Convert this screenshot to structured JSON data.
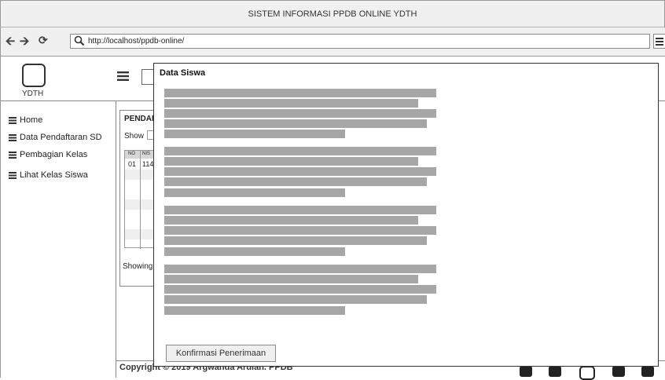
{
  "window": {
    "title": "SISTEM INFORMASI PPDB ONLINE YDTH"
  },
  "browser": {
    "url": "http://localhost/ppdb-online/",
    "back_icon": "back-arrow-icon",
    "forward_icon": "forward-arrow-icon",
    "reload_icon": "reload-icon"
  },
  "header": {
    "logo_text": "YDTH"
  },
  "sidebar": {
    "items": [
      {
        "label": "Home"
      },
      {
        "label": "Data Pendaftaran SD"
      },
      {
        "label": "Pembagian Kelas"
      },
      {
        "label": "Lihat Kelas Siswa"
      }
    ]
  },
  "panel": {
    "title": "PENDAFTARAN",
    "show_label": "Show",
    "table_headers": [
      "NO",
      "NIS"
    ],
    "first_row": [
      "01",
      "114"
    ],
    "showing_text": "Showing"
  },
  "footer": {
    "copyright": "Copyright © 2019 Argwanda Ardian. PPDB"
  },
  "modal": {
    "title": "Data Siswa",
    "confirm_label": "Konfirmasi Penerimaan"
  }
}
